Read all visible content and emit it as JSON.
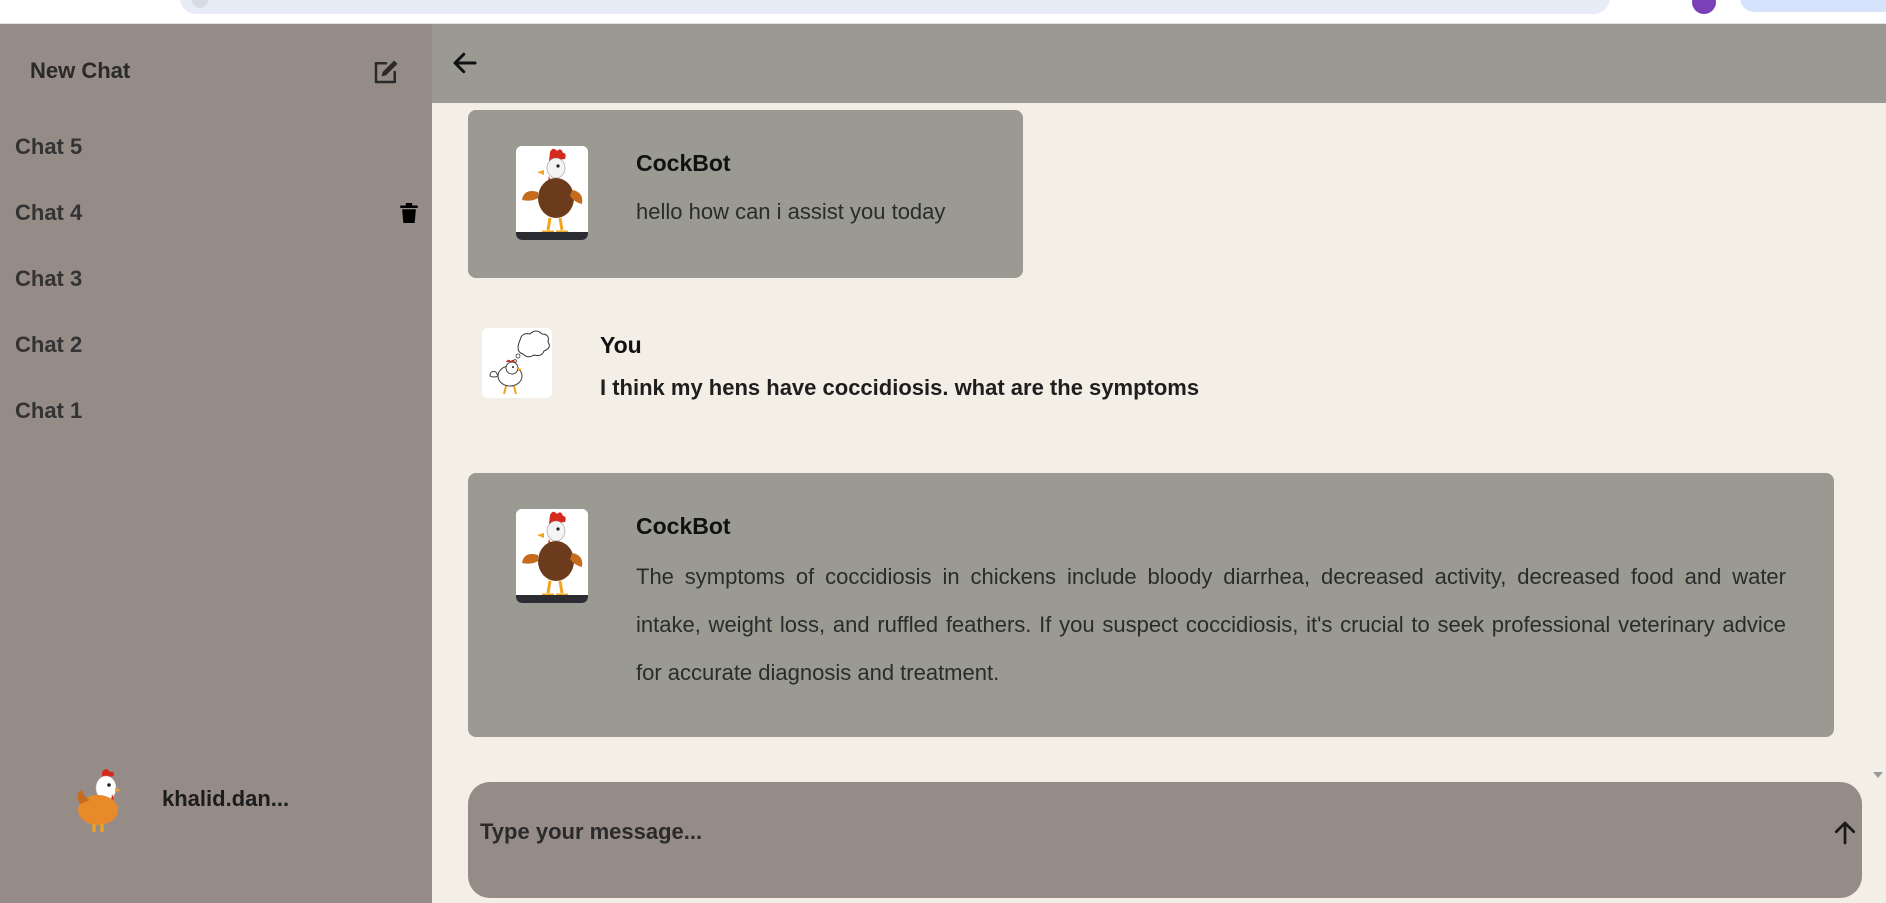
{
  "sidebar": {
    "new_chat_label": "New Chat",
    "chats": [
      {
        "label": "Chat 5"
      },
      {
        "label": "Chat 4"
      },
      {
        "label": "Chat 3"
      },
      {
        "label": "Chat 2"
      },
      {
        "label": "Chat 1"
      }
    ],
    "hovered_chat_index": 1,
    "user_name": "khalid.dan..."
  },
  "messages": [
    {
      "sender": "CockBot",
      "text": "hello how can i assist you today",
      "role": "bot"
    },
    {
      "sender": "You",
      "text": "I think my hens have coccidiosis. what are the symptoms",
      "role": "user"
    },
    {
      "sender": "CockBot",
      "text": "The symptoms of coccidiosis in chickens include bloody diarrhea, decreased activity, decreased food and water intake, weight loss, and ruffled feathers. If you suspect coccidiosis, it's crucial to seek professional veterinary advice for accurate diagnosis and treatment.",
      "role": "bot"
    }
  ],
  "composer": {
    "placeholder": "Type your message...",
    "value": ""
  },
  "icons": {
    "edit": "edit-icon",
    "trash": "trash-icon",
    "back": "arrow-left-icon",
    "send": "arrow-up-icon"
  },
  "colors": {
    "sidebar_bg": "#958c88",
    "header_bg": "#9a9a92",
    "main_bg": "#f3efe6",
    "bot_bubble_bg": "#9a9a92",
    "composer_bg": "#958c88"
  }
}
